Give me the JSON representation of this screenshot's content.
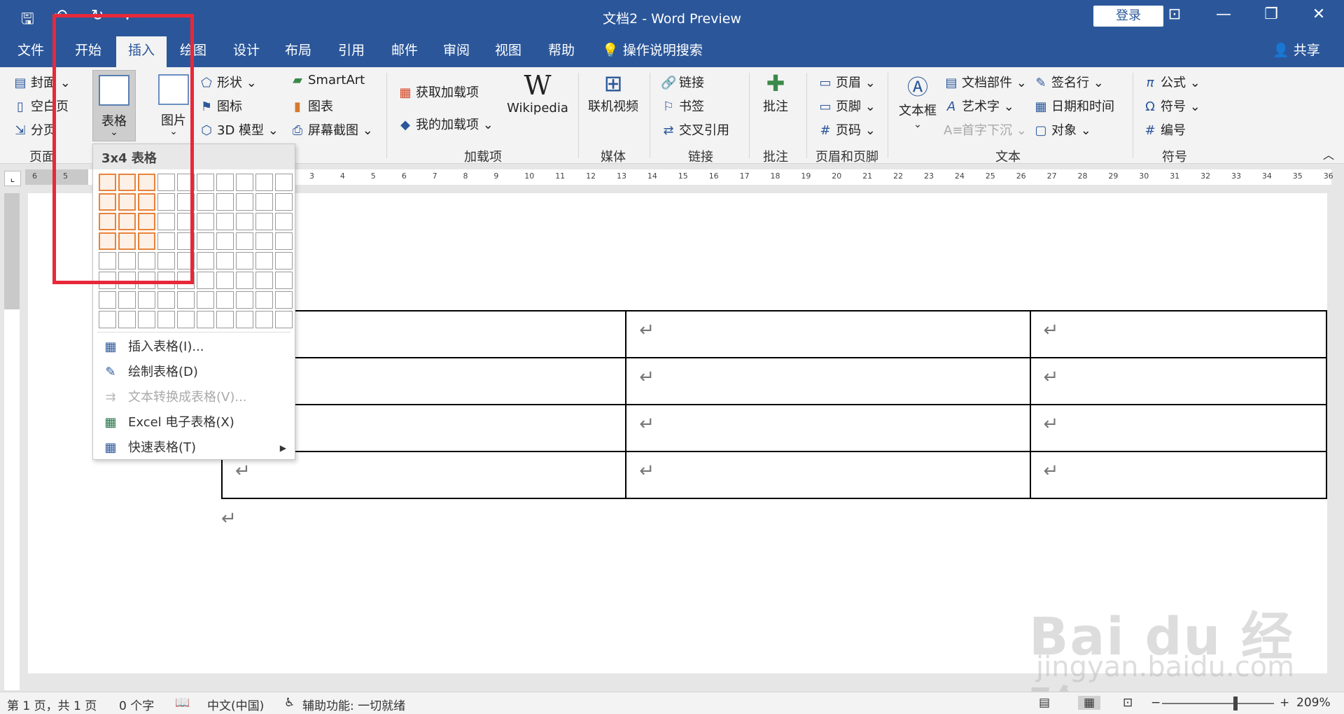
{
  "window": {
    "title": "文档2  -  Word Preview",
    "login": "登录",
    "qa_icons": [
      "save-icon",
      "undo-icon",
      "redo-icon",
      "customize-icon"
    ],
    "win_icons": [
      "ribbon-display-icon",
      "minimize-icon",
      "restore-icon",
      "close-icon"
    ]
  },
  "tabs": [
    {
      "label": "文件"
    },
    {
      "label": "开始"
    },
    {
      "label": "插入",
      "active": true
    },
    {
      "label": "绘图"
    },
    {
      "label": "设计"
    },
    {
      "label": "布局"
    },
    {
      "label": "引用"
    },
    {
      "label": "邮件"
    },
    {
      "label": "审阅"
    },
    {
      "label": "视图"
    },
    {
      "label": "帮助"
    }
  ],
  "tell_me": "操作说明搜索",
  "share": "共享",
  "ribbon": {
    "pages": {
      "cover": "封面",
      "blank": "空白页",
      "break": "分页",
      "group": "页面"
    },
    "table": {
      "label": "表格",
      "arrow": "⌄"
    },
    "picture": {
      "label": "图片"
    },
    "illustrations": {
      "shapes": "形状",
      "icons": "图标",
      "model3d": "3D 模型",
      "smartart": "SmartArt",
      "chart": "图表",
      "screenshot": "屏幕截图"
    },
    "addins": {
      "get": "获取加载项",
      "mine": "我的加载项",
      "wiki": "Wikipedia",
      "group": "加载项"
    },
    "media": {
      "video": "联机视频",
      "group": "媒体"
    },
    "links": {
      "link": "链接",
      "bookmark": "书签",
      "xref": "交叉引用",
      "group": "链接"
    },
    "comments": {
      "comment": "批注",
      "group": "批注"
    },
    "header_footer": {
      "header": "页眉",
      "footer": "页脚",
      "page_number": "页码",
      "group": "页眉和页脚"
    },
    "text": {
      "textbox": "文本框",
      "quickparts": "文档部件",
      "wordart": "艺术字",
      "dropcap": "首字下沉",
      "signature": "签名行",
      "datetime": "日期和时间",
      "object": "对象",
      "group": "文本"
    },
    "symbols": {
      "equation": "公式",
      "symbol": "符号",
      "numbering": "编号",
      "group": "符号"
    }
  },
  "ruler": {
    "left_numbers": [
      "6",
      "5"
    ],
    "numbers": [
      "3",
      "4",
      "5",
      "6",
      "7",
      "8",
      "9",
      "10",
      "11",
      "12",
      "13",
      "14",
      "15",
      "16",
      "17",
      "18",
      "19",
      "20",
      "21",
      "22",
      "23",
      "24",
      "25",
      "26",
      "27",
      "28",
      "29",
      "30",
      "31",
      "32",
      "33",
      "34",
      "35",
      "36"
    ]
  },
  "dropdown": {
    "header": "3x4 表格",
    "grid_cols": 10,
    "grid_rows": 8,
    "selected_cols": 3,
    "selected_rows": 4,
    "items": [
      {
        "label": "插入表格(I)...",
        "icon": "insert-table-icon"
      },
      {
        "label": "绘制表格(D)",
        "icon": "draw-table-icon"
      },
      {
        "label": "文本转换成表格(V)...",
        "icon": "text-to-table-icon",
        "disabled": true
      },
      {
        "label": "Excel 电子表格(X)",
        "icon": "excel-icon"
      },
      {
        "label": "快速表格(T)",
        "icon": "quick-table-icon",
        "submenu": true
      }
    ]
  },
  "document": {
    "rows": 4,
    "cols": 3,
    "return_mark": "↵"
  },
  "status": {
    "page": "第 1 页，共 1 页",
    "words": "0 个字",
    "language": "中文(中国)",
    "accessibility": "辅助功能: 一切就绪",
    "zoom": "209%"
  },
  "watermark": {
    "main": "Bai du 经验",
    "sub": "jingyan.baidu.com"
  },
  "colors": {
    "brand": "#2b579a",
    "ribbon_bg": "#f3f3f3",
    "highlight": "#e8823a",
    "annotation": "#e8283a"
  }
}
